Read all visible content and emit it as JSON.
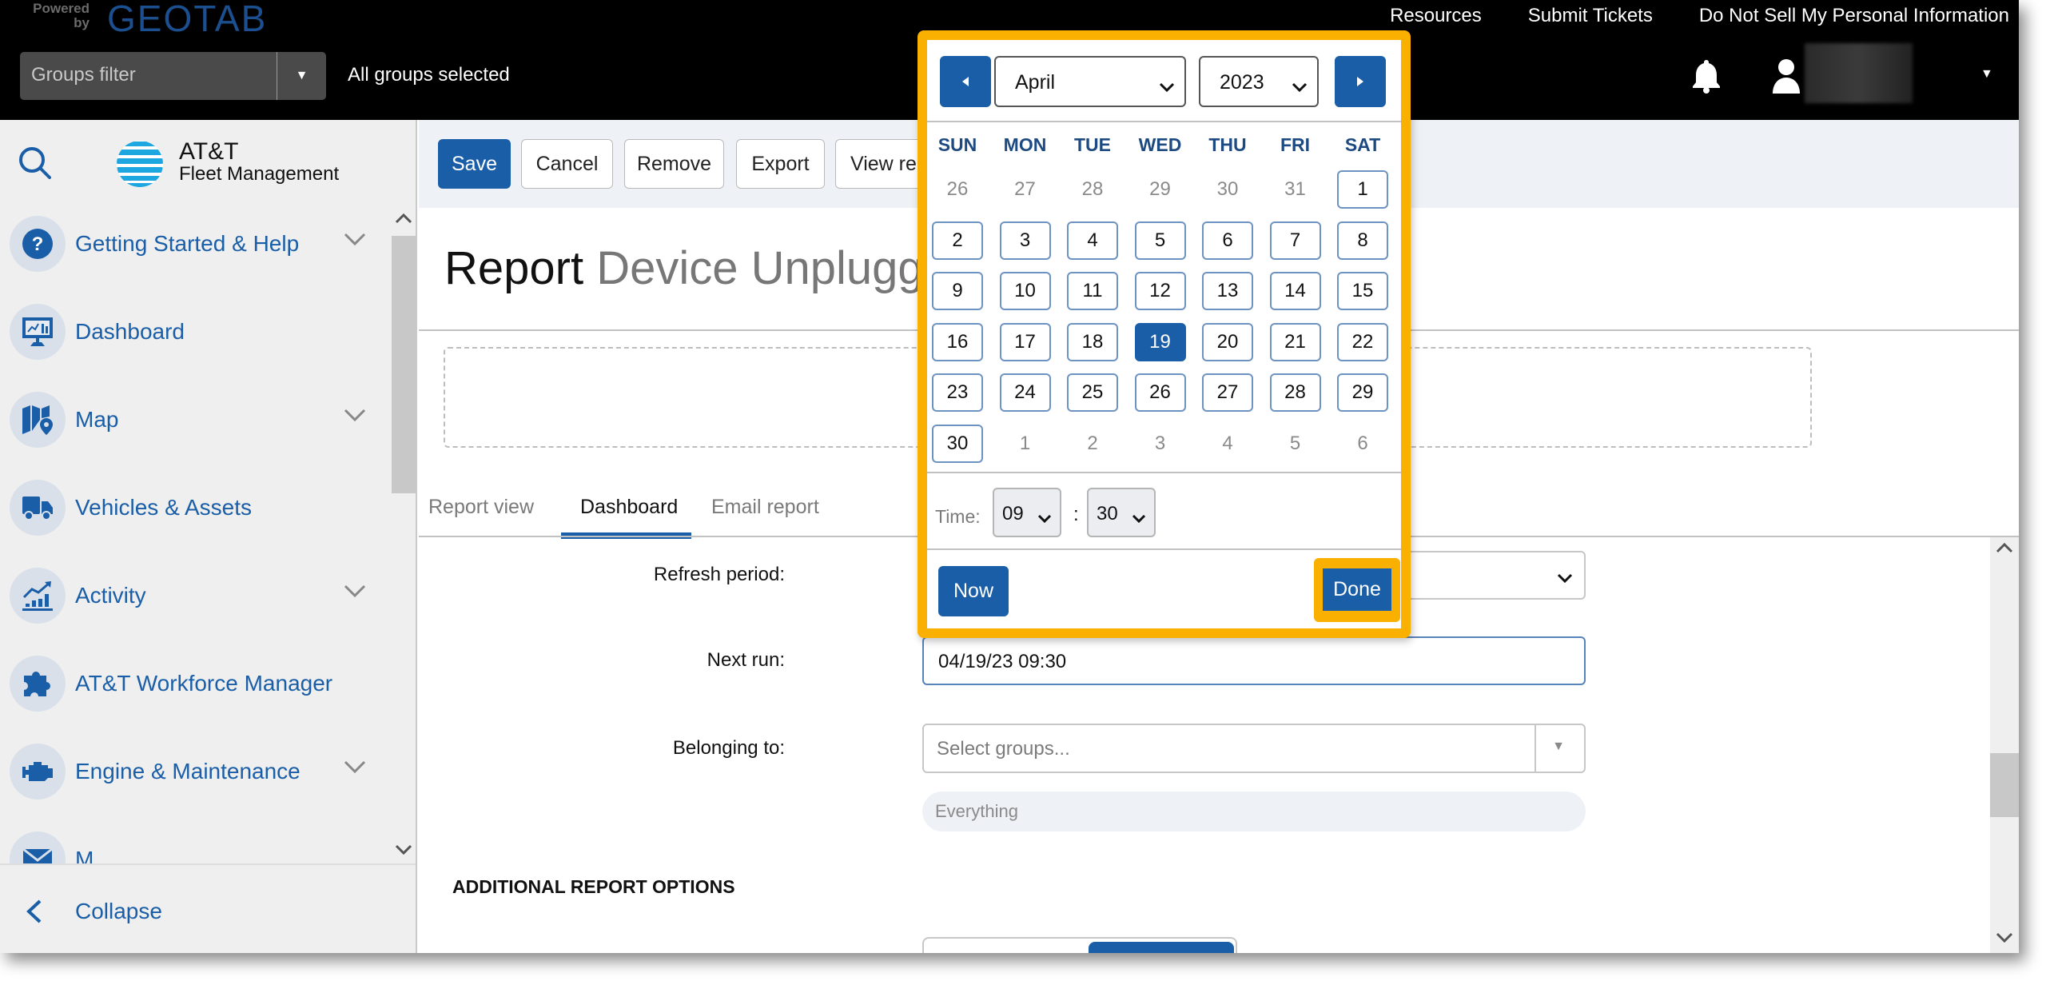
{
  "topbar": {
    "powered_by": "Powered by",
    "brand": "GEOTAB",
    "links": [
      "Resources",
      "Submit Tickets",
      "Do Not Sell My Personal Information"
    ],
    "groups_filter_placeholder": "Groups filter",
    "groups_status": "All groups selected",
    "icons": {
      "notifications": "bell-icon",
      "user": "user-icon",
      "menu": "caret-down-icon"
    }
  },
  "sidebar": {
    "logo_line1": "AT&T",
    "logo_line2": "Fleet Management",
    "items": [
      {
        "label": "Getting Started & Help",
        "icon": "help-icon",
        "expandable": true
      },
      {
        "label": "Dashboard",
        "icon": "dashboard-icon",
        "expandable": false
      },
      {
        "label": "Map",
        "icon": "map-icon",
        "expandable": true
      },
      {
        "label": "Vehicles & Assets",
        "icon": "truck-icon",
        "expandable": false
      },
      {
        "label": "Activity",
        "icon": "activity-icon",
        "expandable": true
      },
      {
        "label": "AT&T Workforce Manager",
        "icon": "puzzle-icon",
        "expandable": false
      },
      {
        "label": "Engine & Maintenance",
        "icon": "engine-icon",
        "expandable": true
      },
      {
        "label": "M",
        "icon": "mail-icon",
        "expandable": false
      }
    ],
    "collapse_label": "Collapse"
  },
  "toolbar": {
    "buttons": [
      "Save",
      "Cancel",
      "Remove",
      "Export",
      "View re"
    ]
  },
  "page": {
    "title_prefix": "Report",
    "title_name": "Device Unplugged"
  },
  "tabs": [
    {
      "label": "Report view",
      "active": false
    },
    {
      "label": "Dashboard",
      "active": true
    },
    {
      "label": "Email report",
      "active": false
    }
  ],
  "form": {
    "refresh_period_label": "Refresh period:",
    "refresh_period_value": "",
    "next_run_label": "Next run:",
    "next_run_value": "04/19/23 09:30",
    "belonging_label": "Belonging to:",
    "belonging_placeholder": "Select groups...",
    "belonging_value": "Everything",
    "additional_options_heading": "ADDITIONAL REPORT OPTIONS"
  },
  "calendar": {
    "month": "April",
    "year": "2023",
    "weekdays": [
      "SUN",
      "MON",
      "TUE",
      "WED",
      "THU",
      "FRI",
      "SAT"
    ],
    "weeks": [
      [
        {
          "d": "26",
          "o": true
        },
        {
          "d": "27",
          "o": true
        },
        {
          "d": "28",
          "o": true
        },
        {
          "d": "29",
          "o": true
        },
        {
          "d": "30",
          "o": true
        },
        {
          "d": "31",
          "o": true
        },
        {
          "d": "1"
        }
      ],
      [
        {
          "d": "2"
        },
        {
          "d": "3"
        },
        {
          "d": "4"
        },
        {
          "d": "5"
        },
        {
          "d": "6"
        },
        {
          "d": "7"
        },
        {
          "d": "8"
        }
      ],
      [
        {
          "d": "9"
        },
        {
          "d": "10"
        },
        {
          "d": "11"
        },
        {
          "d": "12"
        },
        {
          "d": "13"
        },
        {
          "d": "14"
        },
        {
          "d": "15"
        }
      ],
      [
        {
          "d": "16"
        },
        {
          "d": "17"
        },
        {
          "d": "18"
        },
        {
          "d": "19",
          "s": true
        },
        {
          "d": "20"
        },
        {
          "d": "21"
        },
        {
          "d": "22"
        }
      ],
      [
        {
          "d": "23"
        },
        {
          "d": "24"
        },
        {
          "d": "25"
        },
        {
          "d": "26"
        },
        {
          "d": "27"
        },
        {
          "d": "28"
        },
        {
          "d": "29"
        }
      ],
      [
        {
          "d": "30"
        },
        {
          "d": "1",
          "o": true
        },
        {
          "d": "2",
          "o": true
        },
        {
          "d": "3",
          "o": true
        },
        {
          "d": "4",
          "o": true
        },
        {
          "d": "5",
          "o": true
        },
        {
          "d": "6",
          "o": true
        }
      ]
    ],
    "selected_day": "19",
    "time_label": "Time:",
    "hour": "09",
    "minute": "30",
    "now_label": "Now",
    "done_label": "Done"
  },
  "colors": {
    "primary": "#1a5ea8",
    "highlight": "#f9b000",
    "topbar_bg": "#000000",
    "sidebar_bg": "#efefef"
  }
}
